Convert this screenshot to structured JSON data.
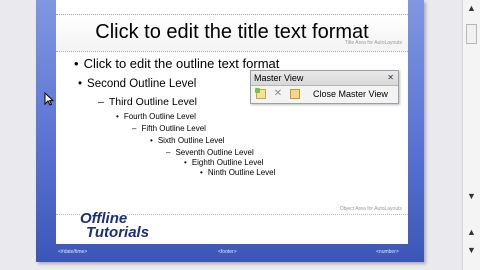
{
  "slide": {
    "title": "Click to edit the title text format",
    "title_placeholder_note": "Title Area for AutoLayouts",
    "body_placeholder_note": "Object Area for AutoLayouts",
    "outline": [
      "Click to edit the outline text format",
      "Second Outline Level",
      "Third Outline Level",
      "Fourth Outline Level",
      "Fifth Outline Level",
      "Sixth Outline Level",
      "Seventh Outline Level",
      "Eighth Outline Level",
      "Ninth Outline Level"
    ],
    "bullets": [
      "•",
      "•",
      "–",
      "•",
      "–",
      "•",
      "–",
      "•",
      "•"
    ],
    "footer": {
      "date": "<#date/time>",
      "footer": "<footer>",
      "number": "<number>"
    }
  },
  "logo": {
    "line1": "Offline",
    "line2": "Tutorials"
  },
  "master_toolbar": {
    "title": "Master View",
    "close_label": "Close Master View",
    "close_glyph": "✕"
  },
  "colors": {
    "slide_frame": "#5a73d2",
    "logo_text": "#1c2f7a"
  }
}
